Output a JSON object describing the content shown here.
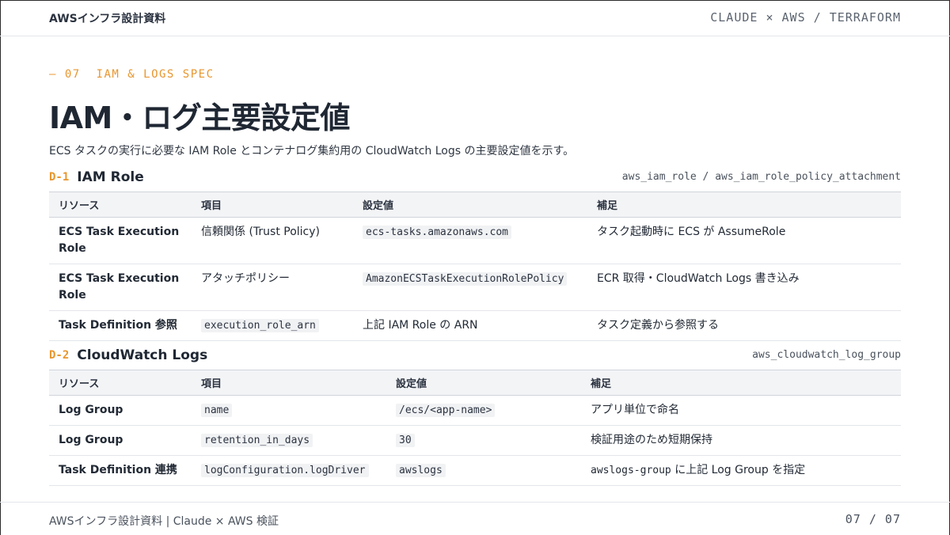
{
  "header": {
    "brand": "AWSインフラ設計資料",
    "meta": "CLAUDE × AWS / TERRAFORM"
  },
  "eyebrow": "— 07  IAM & LOGS SPEC",
  "title": "IAM・ログ主要設定値",
  "lead": "ECS タスクの実行に必要な IAM Role とコンテナログ集約用の CloudWatch Logs の主要設定値を示す。",
  "section1": {
    "code": "D-1",
    "name": "IAM Role",
    "resources": "aws_iam_role / aws_iam_role_policy_attachment",
    "headers": [
      "リソース",
      "項目",
      "設定値",
      "補足"
    ],
    "rows": [
      [
        "ECS Task Execution Role",
        "信頼関係 (Trust Policy)",
        "ecs-tasks.amazonaws.com",
        "タスク起動時に ECS が AssumeRole"
      ],
      [
        "ECS Task Execution Role",
        "アタッチポリシー",
        "AmazonECSTaskExecutionRolePolicy",
        "ECR 取得・CloudWatch Logs 書き込み"
      ],
      [
        "Task Definition 参照",
        "execution_role_arn",
        "上記 IAM Role の ARN",
        "タスク定義から参照する"
      ]
    ]
  },
  "section2": {
    "code": "D-2",
    "name": "CloudWatch Logs",
    "resources": "aws_cloudwatch_log_group",
    "headers": [
      "リソース",
      "項目",
      "設定値",
      "補足"
    ],
    "rows": [
      [
        "Log Group",
        "name",
        "/ecs/<app-name>",
        "アプリ単位で命名"
      ],
      [
        "Log Group",
        "retention_in_days",
        "30",
        "検証用途のため短期保持"
      ],
      [
        "Task Definition 連携",
        "logConfiguration.logDriver",
        "awslogs",
        "に上記 Log Group を指定"
      ]
    ],
    "note_code": "awslogs-group"
  },
  "footer": {
    "left": "AWSインフラ設計資料 | Claude × AWS 検証",
    "page": "07 / 07"
  }
}
